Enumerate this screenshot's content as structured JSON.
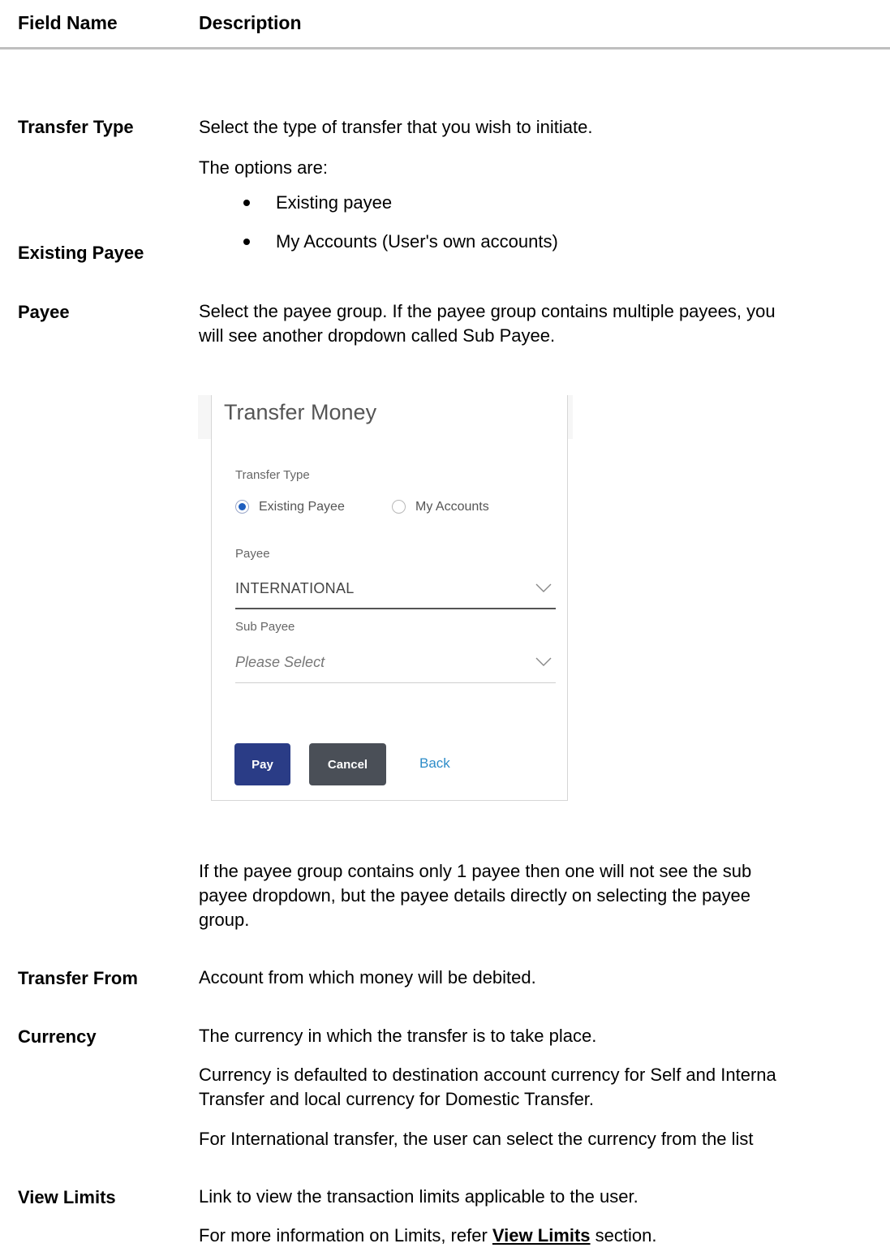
{
  "table": {
    "col_field": "Field Name",
    "col_desc": "Description"
  },
  "transfer_type": {
    "name": "Transfer Type",
    "desc": "Select the type of transfer that you wish to initiate.",
    "options_intro": "The options are:",
    "options": [
      "Existing payee",
      "My Accounts (User's own accounts)"
    ]
  },
  "existing_payee_heading": "Existing Payee",
  "payee": {
    "name": "Payee",
    "desc_line1": "Select the payee group. If the payee group contains multiple payees, you",
    "desc_line2": "will see another dropdown called Sub Payee.",
    "after_line1": "If the payee group contains only 1 payee then one will not see the sub",
    "after_line2": "payee dropdown, but the payee details directly on selecting the payee",
    "after_line3": "group."
  },
  "screenshot": {
    "title": "Transfer Money",
    "transfer_type_label": "Transfer Type",
    "radio_existing": "Existing Payee",
    "radio_my_accounts": "My Accounts",
    "payee_label": "Payee",
    "payee_value": "INTERNATIONAL",
    "sub_payee_label": "Sub Payee",
    "sub_payee_placeholder": "Please Select",
    "pay_button": "Pay",
    "cancel_button": "Cancel",
    "back_link": "Back",
    "accent_color": "#1f5fbf",
    "pay_color": "#2a3c86",
    "cancel_color": "#4a4f57"
  },
  "transfer_from": {
    "name": "Transfer From",
    "desc": "Account from which money will be debited."
  },
  "currency": {
    "name": "Currency",
    "desc": "The currency in which the transfer is to take place.",
    "desc2_line1": "Currency is defaulted to destination account currency for Self and Interna",
    "desc2_line2": "Transfer and local currency for Domestic Transfer.",
    "desc3": "For International transfer, the user can select the currency from the list"
  },
  "view_limits": {
    "name": "View Limits",
    "desc": "Link to view the transaction limits applicable to the user.",
    "more_prefix": "For more information on Limits, refer ",
    "more_link": "View Limits",
    "more_suffix": " section."
  }
}
